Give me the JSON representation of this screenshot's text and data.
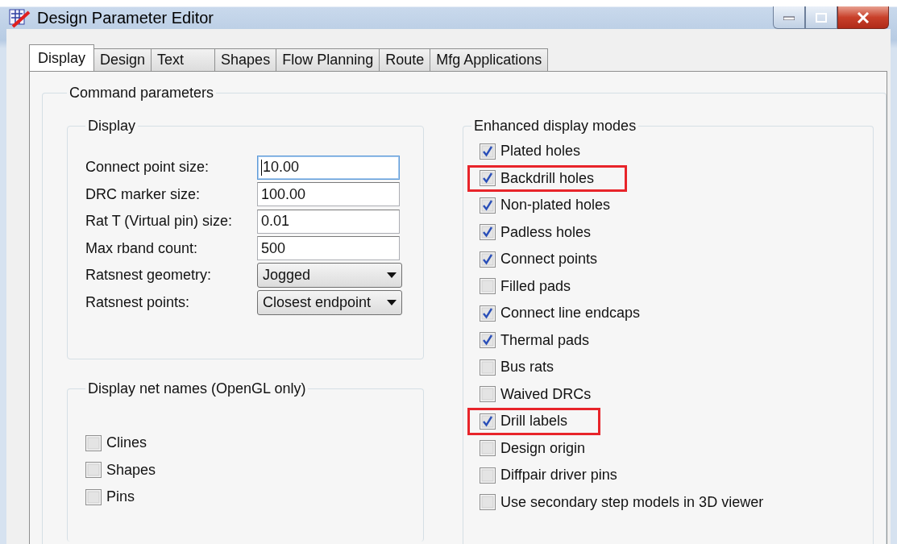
{
  "window": {
    "title": "Design Parameter Editor"
  },
  "tabs": [
    {
      "label": "Display",
      "selected": true
    },
    {
      "label": "Design",
      "selected": false
    },
    {
      "label": "Text",
      "selected": false
    },
    {
      "label": "Shapes",
      "selected": false
    },
    {
      "label": "Flow Planning",
      "selected": false
    },
    {
      "label": "Route",
      "selected": false
    },
    {
      "label": "Mfg Applications",
      "selected": false
    }
  ],
  "command_parameters": {
    "title": "Command parameters",
    "display": {
      "title": "Display",
      "fields": [
        {
          "label": "Connect point size:",
          "kind": "text",
          "value": "10.00",
          "focused": true
        },
        {
          "label": "DRC marker size:",
          "kind": "text",
          "value": "100.00",
          "focused": false
        },
        {
          "label": "Rat T (Virtual pin) size:",
          "kind": "text",
          "value": "0.01",
          "focused": false
        },
        {
          "label": "Max rband count:",
          "kind": "text",
          "value": "500",
          "focused": false
        },
        {
          "label": "Ratsnest geometry:",
          "kind": "dropdown",
          "value": "Jogged"
        },
        {
          "label": "Ratsnest points:",
          "kind": "dropdown",
          "value": "Closest endpoint"
        }
      ]
    },
    "net_names": {
      "title": "Display net names (OpenGL only)",
      "options": [
        {
          "label": "Clines",
          "checked": false
        },
        {
          "label": "Shapes",
          "checked": false
        },
        {
          "label": "Pins",
          "checked": false
        }
      ]
    },
    "enhanced_display_modes": {
      "title": "Enhanced display modes",
      "options": [
        {
          "label": "Plated holes",
          "checked": true,
          "highlighted": false
        },
        {
          "label": "Backdrill holes",
          "checked": true,
          "highlighted": true
        },
        {
          "label": "Non-plated holes",
          "checked": true,
          "highlighted": false
        },
        {
          "label": "Padless holes",
          "checked": true,
          "highlighted": false
        },
        {
          "label": "Connect points",
          "checked": true,
          "highlighted": false
        },
        {
          "label": "Filled pads",
          "checked": false,
          "highlighted": false
        },
        {
          "label": "Connect line endcaps",
          "checked": true,
          "highlighted": false
        },
        {
          "label": "Thermal pads",
          "checked": true,
          "highlighted": false
        },
        {
          "label": "Bus rats",
          "checked": false,
          "highlighted": false
        },
        {
          "label": "Waived DRCs",
          "checked": false,
          "highlighted": false
        },
        {
          "label": "Drill labels",
          "checked": true,
          "highlighted": true
        },
        {
          "label": "Design origin",
          "checked": false,
          "highlighted": false
        },
        {
          "label": "Diffpair driver pins",
          "checked": false,
          "highlighted": false
        },
        {
          "label": "Use secondary step models in 3D viewer",
          "checked": false,
          "highlighted": false
        }
      ]
    }
  }
}
